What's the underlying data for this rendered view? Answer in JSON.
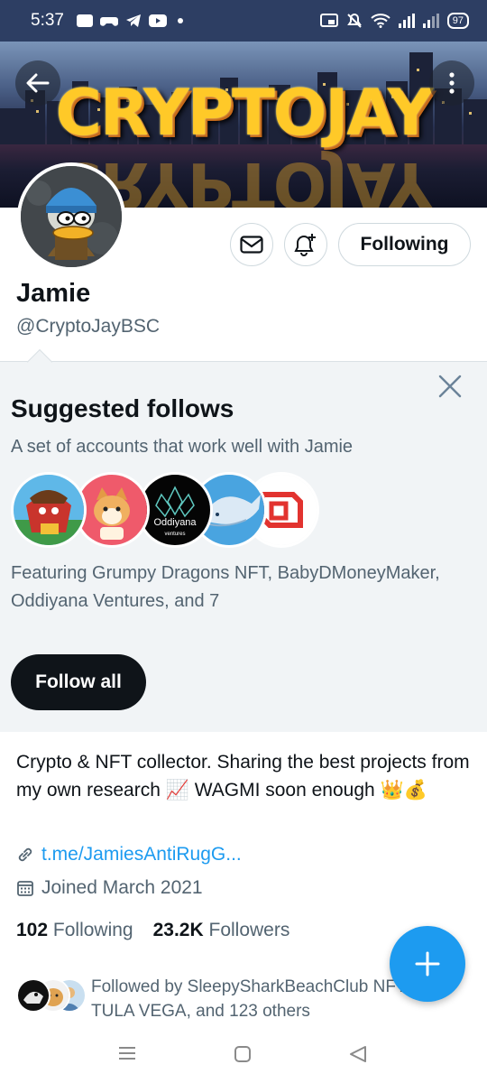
{
  "status_bar": {
    "time": "5:37",
    "battery": "97",
    "icons": [
      "discord-icon",
      "controller-icon",
      "telegram-icon",
      "youtube-icon",
      "dot-icon",
      "cast-icon",
      "mute-icon",
      "wifi-icon",
      "signal-icon",
      "signal-icon-2",
      "battery-icon"
    ]
  },
  "banner": {
    "title": "CRYPTOJAY"
  },
  "top_nav": {
    "back_icon": "arrow-left-icon",
    "more_icon": "more-vertical-icon"
  },
  "profile": {
    "display_name": "Jamie",
    "handle": "@CryptoJayBSC",
    "following_label": "Following",
    "mail_icon": "mail-icon",
    "notify_icon": "bell-plus-icon"
  },
  "suggested": {
    "title": "Suggested follows",
    "subtitle": "A set of accounts that work well with Jamie",
    "featuring": "Featuring Grumpy Dragons NFT, BabyDMoneyMaker, Oddiyana Ventures, and 7",
    "follow_all_label": "Follow all",
    "close_icon": "close-icon",
    "avatar_texts": [
      "Oddiyana",
      "ventures"
    ]
  },
  "bio": {
    "text": "Crypto & NFT collector. Sharing the best projects from my own research 📈 WAGMI soon enough 👑💰",
    "link": "t.me/JamiesAntiRugG...",
    "joined": "Joined March 2021"
  },
  "stats": {
    "following_count": "102",
    "following_label": "Following",
    "followers_count": "23.2K",
    "followers_label": "Followers"
  },
  "followed_by": {
    "text": "Followed by SleepySharkBeachClub NFT, TULA VEGA, and 123 others"
  },
  "fab": {
    "icon": "plus-icon"
  },
  "system_nav": {
    "icons": [
      "recents-icon",
      "home-icon",
      "back-triangle-icon"
    ]
  },
  "colors": {
    "accent": "#1d9bf0",
    "secondary_text": "#536471",
    "panel_bg": "#f1f4f6",
    "banner_text": "#ffc928"
  }
}
